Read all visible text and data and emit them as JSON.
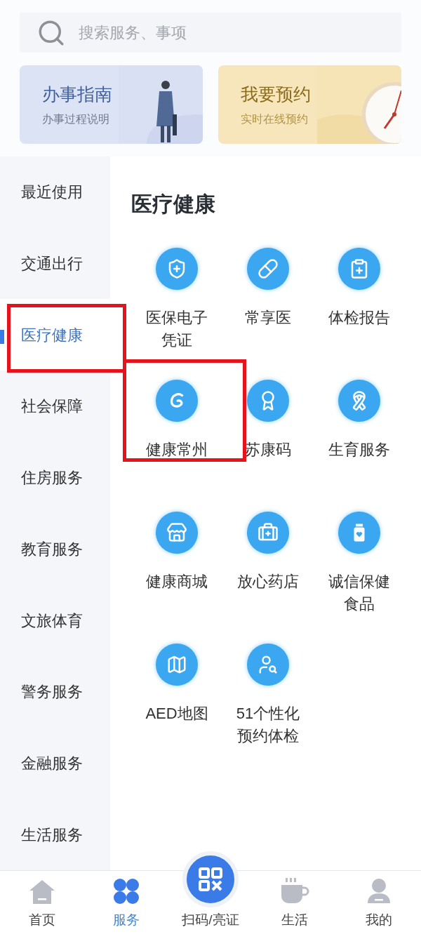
{
  "search": {
    "placeholder": "搜索服务、事项"
  },
  "cards": [
    {
      "kind": "guide",
      "title": "办事指南",
      "subtitle": "办事过程说明"
    },
    {
      "kind": "booking",
      "title": "我要预约",
      "subtitle": "实时在线预约"
    }
  ],
  "sidebar": {
    "items": [
      {
        "label": "最近使用",
        "selected": false,
        "highlighted": false
      },
      {
        "label": "交通出行",
        "selected": false,
        "highlighted": false
      },
      {
        "label": "医疗健康",
        "selected": true,
        "highlighted": true
      },
      {
        "label": "社会保障",
        "selected": false,
        "highlighted": false
      },
      {
        "label": "住房服务",
        "selected": false,
        "highlighted": false
      },
      {
        "label": "教育服务",
        "selected": false,
        "highlighted": false
      },
      {
        "label": "文旅体育",
        "selected": false,
        "highlighted": false
      },
      {
        "label": "警务服务",
        "selected": false,
        "highlighted": false
      },
      {
        "label": "金融服务",
        "selected": false,
        "highlighted": false
      },
      {
        "label": "生活服务",
        "selected": false,
        "highlighted": false
      }
    ]
  },
  "section": {
    "title": "医疗健康",
    "services": [
      {
        "kind": "insurance",
        "lines": [
          "医保电子",
          "凭证"
        ],
        "highlighted": false
      },
      {
        "kind": "pill",
        "lines": [
          "常享医"
        ],
        "highlighted": false
      },
      {
        "kind": "report",
        "lines": [
          "体检报告"
        ],
        "highlighted": false
      },
      {
        "kind": "swirl",
        "lines": [
          "健康常州"
        ],
        "highlighted": true
      },
      {
        "kind": "badge",
        "lines": [
          "苏康码"
        ],
        "highlighted": false
      },
      {
        "kind": "ribbon",
        "lines": [
          "生育服务"
        ],
        "highlighted": false
      },
      {
        "kind": "store",
        "lines": [
          "健康商城"
        ],
        "highlighted": false
      },
      {
        "kind": "pharmacy",
        "lines": [
          "放心药店"
        ],
        "highlighted": false
      },
      {
        "kind": "jar",
        "lines": [
          "诚信保健",
          "食品"
        ],
        "highlighted": false
      },
      {
        "kind": "map",
        "lines": [
          "AED地图"
        ],
        "highlighted": false
      },
      {
        "kind": "checkup",
        "lines": [
          "51个性化",
          "预约体检"
        ],
        "highlighted": false
      }
    ]
  },
  "bottom_nav": [
    {
      "kind": "home",
      "label": "首页",
      "selected": false
    },
    {
      "kind": "services",
      "label": "服务",
      "selected": true
    },
    {
      "kind": "scan",
      "label": "扫码/亮证",
      "selected": false
    },
    {
      "kind": "life",
      "label": "生活",
      "selected": false
    },
    {
      "kind": "me",
      "label": "我的",
      "selected": false
    }
  ]
}
